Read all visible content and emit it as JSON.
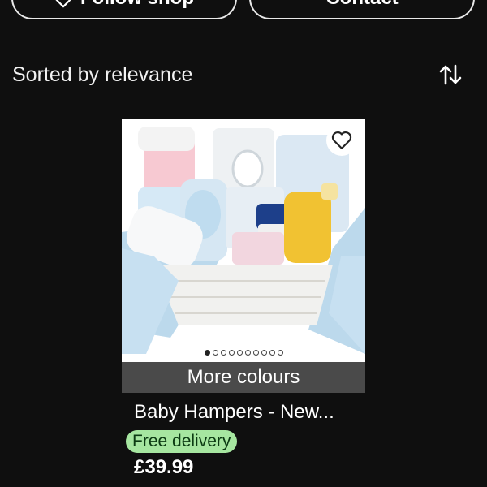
{
  "header": {
    "follow_label": "Follow shop",
    "contact_label": "Contact"
  },
  "sort": {
    "label": "Sorted by relevance",
    "icon": "sort-arrows-icon"
  },
  "listing": {
    "title": "Baby Hampers - New...",
    "more_colours_label": "More colours",
    "badge": "Free delivery",
    "price": "£39.99",
    "image_count": 10,
    "active_image_index": 0,
    "favorite_icon": "heart-outline-icon"
  },
  "colors": {
    "background": "#0f0f0f",
    "badge_bg": "#a6e6a0",
    "badge_text": "#0b3a12",
    "overlay": "#4a4a4a"
  }
}
